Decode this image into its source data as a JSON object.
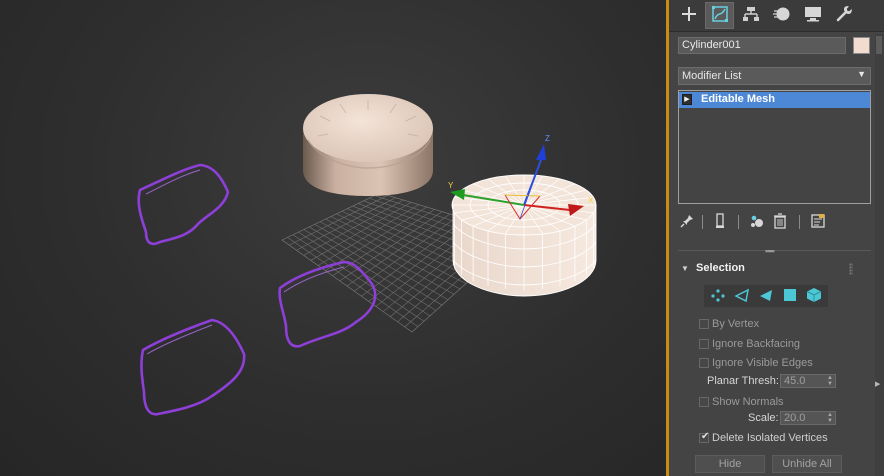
{
  "colors": {
    "viewport_frame": "#c98a16",
    "selection_blue": "#4d88d6",
    "object_color": "#f2dcd0",
    "spline_purple": "#8e3fd8",
    "panel_bg": "#444444",
    "subobject_cyan": "#4cc7d6"
  },
  "viewport": {
    "objects": [
      "cylinder",
      "cylinder-wireframe-selected",
      "grid",
      "spline-shape",
      "spline-shape",
      "spline-shape"
    ],
    "gizmo": {
      "axis_x_label": "X",
      "axis_y_label": "Y",
      "axis_z_label": "Z"
    }
  },
  "command_panel": {
    "tabs": [
      {
        "name": "create",
        "icon": "plus-icon",
        "active": false
      },
      {
        "name": "modify",
        "icon": "modify-icon",
        "active": true
      },
      {
        "name": "hierarchy",
        "icon": "hierarchy-icon",
        "active": false
      },
      {
        "name": "motion",
        "icon": "motion-icon",
        "active": false
      },
      {
        "name": "display",
        "icon": "display-icon",
        "active": false
      },
      {
        "name": "utilities",
        "icon": "wrench-icon",
        "active": false
      }
    ],
    "object_name": "Cylinder001",
    "modifier_list_label": "Modifier List",
    "stack": [
      {
        "label": "Editable Mesh",
        "selected": true
      }
    ],
    "stack_tools": [
      "pin-icon",
      "show-end-result-icon",
      "make-unique-icon",
      "remove-modifier-icon",
      "configure-sets-icon"
    ],
    "selection_rollout": {
      "title": "Selection",
      "subobject_levels": [
        "vertex-icon",
        "edge-icon",
        "face-icon",
        "polygon-icon",
        "element-icon"
      ],
      "by_vertex": {
        "label": "By Vertex",
        "checked": false
      },
      "ignore_backfacing": {
        "label": "Ignore Backfacing",
        "checked": false
      },
      "ignore_visible_edges": {
        "label": "Ignore Visible Edges",
        "checked": false
      },
      "planar_thresh": {
        "label": "Planar Thresh:",
        "value": "45.0"
      },
      "show_normals": {
        "label": "Show Normals",
        "checked": false
      },
      "scale": {
        "label": "Scale:",
        "value": "20.0"
      },
      "delete_isolated_vertices": {
        "label": "Delete Isolated Vertices",
        "checked": true
      },
      "hide_label": "Hide",
      "unhide_all_label": "Unhide All"
    }
  }
}
